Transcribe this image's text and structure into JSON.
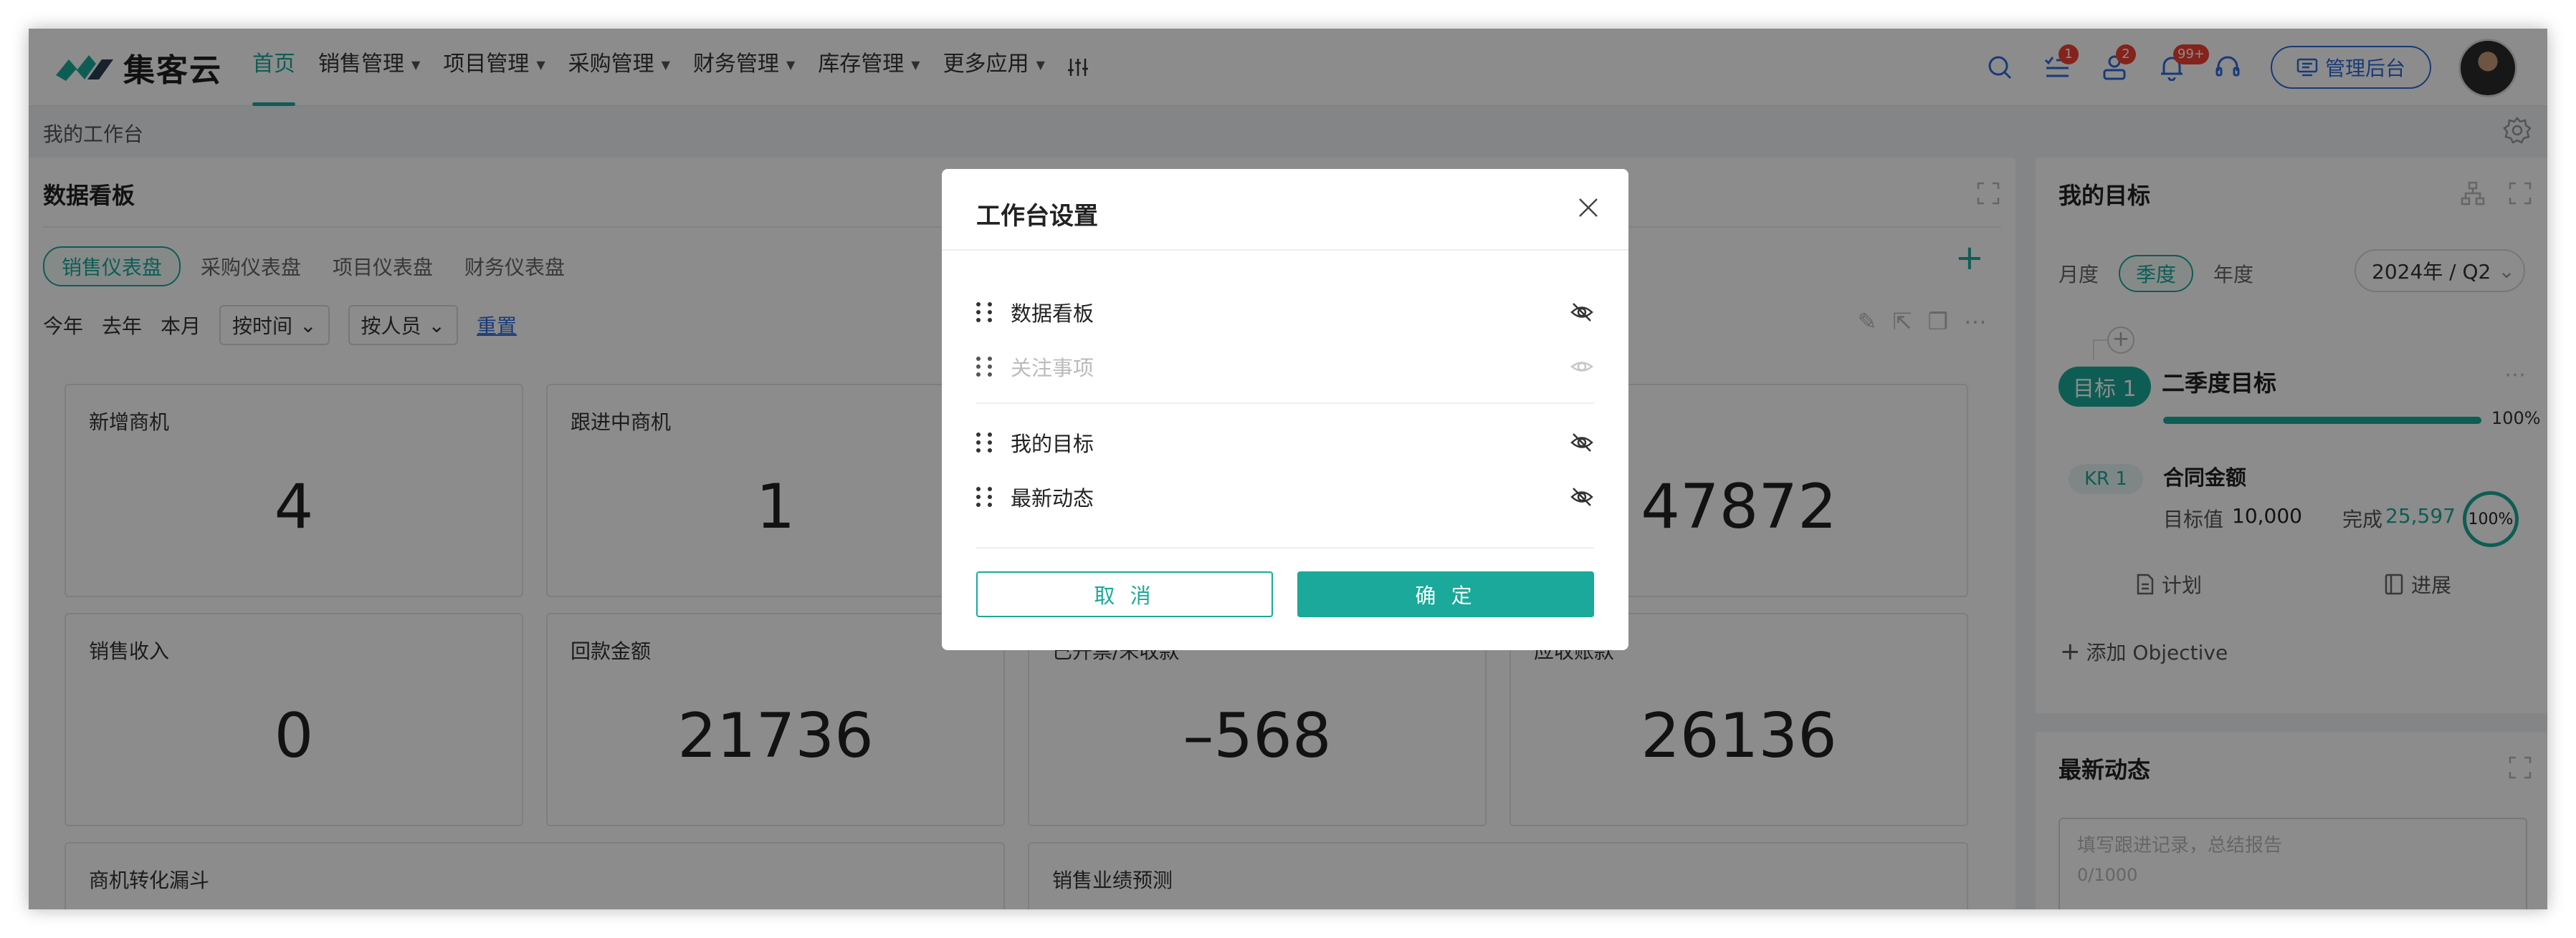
{
  "brand": {
    "name": "集客云"
  },
  "nav": {
    "items": [
      "首页",
      "销售管理",
      "项目管理",
      "采购管理",
      "财务管理",
      "库存管理",
      "更多应用"
    ],
    "more_icon": "sliders-icon"
  },
  "toolbar": {
    "badges": {
      "tasks": "1",
      "contacts": "2",
      "notifications": "99+"
    },
    "admin_label": "管理后台"
  },
  "breadcrumb": "我的工作台",
  "dashboard": {
    "title": "数据看板",
    "tabs": [
      "销售仪表盘",
      "采购仪表盘",
      "项目仪表盘",
      "财务仪表盘"
    ],
    "filters": {
      "quick": [
        "今年",
        "去年",
        "本月"
      ],
      "by_time": "按时间",
      "by_person": "按人员",
      "reset": "重置"
    },
    "stats": [
      {
        "label": "新增商机",
        "value": "4"
      },
      {
        "label": "跟进中商机",
        "value": "1"
      },
      {
        "label": "",
        "value": ""
      },
      {
        "label": "",
        "value": "47872"
      },
      {
        "label": "销售收入",
        "value": "0"
      },
      {
        "label": "回款金额",
        "value": "21736"
      },
      {
        "label": "已开票/未收款",
        "value": "–568"
      },
      {
        "label": "应收账款",
        "value": "26136"
      }
    ],
    "bottom_cards": [
      "商机转化漏斗",
      "销售业绩预测"
    ]
  },
  "goals": {
    "title": "我的目标",
    "periods": [
      "月度",
      "季度",
      "年度"
    ],
    "active_period": "季度",
    "quarter": "2024年 / Q2",
    "objective_tag": "目标 1",
    "objective_name": "二季度目标",
    "progress": 1.0,
    "progress_label": "100%",
    "kr_tag": "KR 1",
    "kr_name": "合同金额",
    "target_label": "目标值",
    "target_value": "10,000",
    "done_label": "完成",
    "done_value": "25,597",
    "done_percent": "100%",
    "plan_label": "计划",
    "progress_btn": "进展",
    "add_objective": "添加 Objective"
  },
  "activity": {
    "title": "最新动态",
    "placeholder": "填写跟进记录，总结报告",
    "counter": "0/1000"
  },
  "modal": {
    "title": "工作台设置",
    "items": [
      {
        "label": "数据看板",
        "visible": true
      },
      {
        "label": "关注事项",
        "visible": false
      },
      {
        "label": "我的目标",
        "visible": true
      },
      {
        "label": "最新动态",
        "visible": true
      }
    ],
    "cancel": "取 消",
    "confirm": "确 定"
  },
  "colors": {
    "accent": "#1aa99a",
    "link": "#2e6bdb",
    "badge": "#f04134"
  }
}
